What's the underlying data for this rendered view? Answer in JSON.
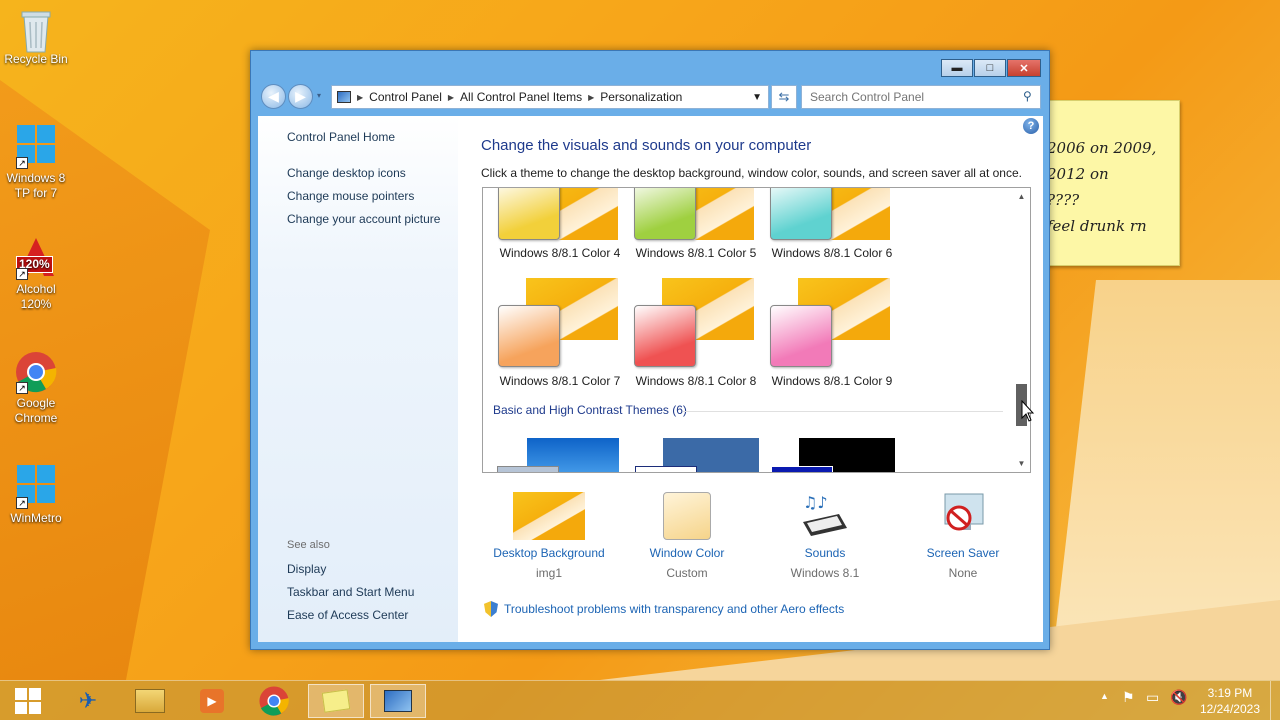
{
  "desktop": {
    "icons": [
      {
        "label": "Recycle Bin",
        "icon": "recycle-bin-icon"
      },
      {
        "label": "Windows 8 TP for 7",
        "icon": "windows-logo-icon"
      },
      {
        "label": "Alcohol 120%",
        "icon": "alcohol-icon",
        "badge": "120%"
      },
      {
        "label": "Google Chrome",
        "icon": "chrome-icon"
      },
      {
        "label": "WinMetro",
        "icon": "windows-logo-icon"
      }
    ],
    "sticky_note": [
      "2006 on 2009,",
      "2012 on",
      "????",
      "feel drunk rn"
    ]
  },
  "window": {
    "buttons": {
      "minimize": "▬",
      "maximize": "□",
      "close": "✕"
    },
    "breadcrumbs": [
      "Control Panel",
      "All Control Panel Items",
      "Personalization"
    ],
    "search_placeholder": "Search Control Panel",
    "left_pane": {
      "home": "Control Panel Home",
      "links": [
        "Change desktop icons",
        "Change mouse pointers",
        "Change your account picture"
      ],
      "see_also_label": "See also",
      "see_also": [
        "Display",
        "Taskbar and Start Menu",
        "Ease of Access Center"
      ]
    },
    "title": "Change the visuals and sounds on your computer",
    "subtitle": "Click a theme to change the desktop background, window color, sounds, and screen saver all at once.",
    "themes_row1": [
      {
        "label": "Windows 8/8.1 Color 4",
        "color": "#f2d03a"
      },
      {
        "label": "Windows 8/8.1 Color 5",
        "color": "#9fd040"
      },
      {
        "label": "Windows 8/8.1 Color 6",
        "color": "#5fd2d0"
      }
    ],
    "themes_row2": [
      {
        "label": "Windows 8/8.1 Color 7",
        "color": "#f6a35c"
      },
      {
        "label": "Windows 8/8.1 Color 8",
        "color": "#ef5252"
      },
      {
        "label": "Windows 8/8.1 Color 9",
        "color": "#f27ab8"
      }
    ],
    "group_header": "Basic and High Contrast Themes (6)",
    "options": [
      {
        "label": "Desktop Background",
        "value": "img1",
        "icon": "desktop-background-icon"
      },
      {
        "label": "Window Color",
        "value": "Custom",
        "icon": "window-color-icon"
      },
      {
        "label": "Sounds",
        "value": "Windows 8.1",
        "icon": "sounds-icon"
      },
      {
        "label": "Screen Saver",
        "value": "None",
        "icon": "screen-saver-icon"
      }
    ],
    "troubleshoot": "Troubleshoot problems with transparency and other Aero effects"
  },
  "taskbar": {
    "time": "3:19 PM",
    "date": "12/24/2023"
  }
}
